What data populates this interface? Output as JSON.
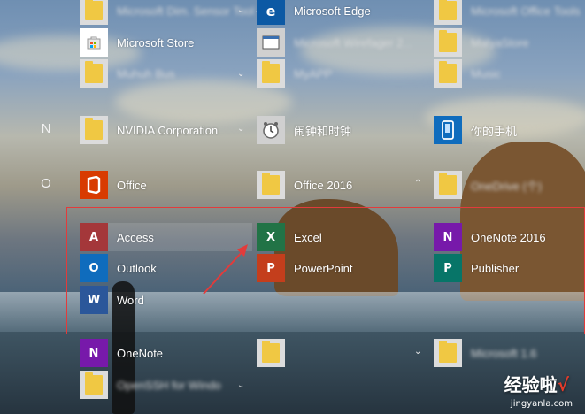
{
  "groups": [
    {
      "letter": "N"
    },
    {
      "letter": "O"
    }
  ],
  "apps": {
    "col1_r0": {
      "label": "Microsoft Dim. Sensor Tool"
    },
    "ms_store": {
      "label": "Microsoft Store"
    },
    "col1_r2": {
      "label": "Muhuh Bus"
    },
    "nvidia": {
      "label": "NVIDIA Corporation"
    },
    "office_folder": {
      "label": "Office"
    },
    "access": {
      "label": "Access"
    },
    "outlook": {
      "label": "Outlook"
    },
    "word": {
      "label": "Word"
    },
    "onenote": {
      "label": "OneNote"
    },
    "openssh": {
      "label": "OpenSSH for Windo"
    },
    "edge": {
      "label": "Microsoft Edge"
    },
    "col2_r1": {
      "label": "Microsoft Wirefager 2..."
    },
    "col2_r2": {
      "label": "MyAPP"
    },
    "alarm": {
      "label": "闹钟和时钟"
    },
    "office2016": {
      "label": "Office 2016"
    },
    "excel": {
      "label": "Excel"
    },
    "powerpoint": {
      "label": "PowerPoint"
    },
    "col3_r0": {
      "label": "Microsoft Office Tools"
    },
    "col3_r1": {
      "label": "MalyaStore"
    },
    "col3_r2": {
      "label": "Music"
    },
    "phone": {
      "label": "你的手机"
    },
    "onedrive": {
      "label": "OneDrive (个)"
    },
    "onenote2016": {
      "label": "OneNote 2016"
    },
    "publisher": {
      "label": "Publisher"
    },
    "col3_r9": {
      "label": "Microsoft 1.6"
    }
  },
  "watermark": {
    "brand": "经验啦",
    "check": "√",
    "url": "jingyanla.com"
  },
  "colors": {
    "office_red": "#d83b01",
    "access": "#a4373a",
    "outlook": "#0f6cbd",
    "word": "#2b579a",
    "excel": "#217346",
    "powerpoint": "#c43e1c",
    "onenote": "#7719aa",
    "publisher": "#077568",
    "edge": "#0c59a4",
    "highlight_box": "#e23b3b"
  }
}
